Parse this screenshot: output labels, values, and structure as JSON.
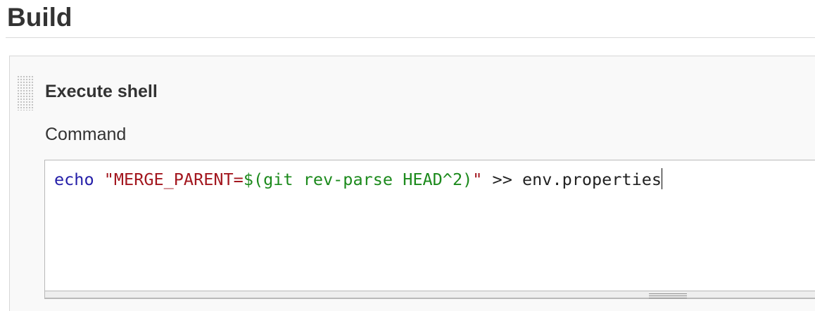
{
  "section": {
    "title": "Build"
  },
  "build_step": {
    "title": "Execute shell",
    "command_label": "Command",
    "command": {
      "keyword": "echo",
      "space1": " ",
      "string_open": "\"MERGE_PARENT=",
      "substitution": "$(git rev-parse HEAD^2)",
      "string_close": "\"",
      "rest": " >> env.properties"
    }
  },
  "colors": {
    "keyword": "#241ea8",
    "string": "#a3171f",
    "substitution": "#1c8a1c"
  }
}
